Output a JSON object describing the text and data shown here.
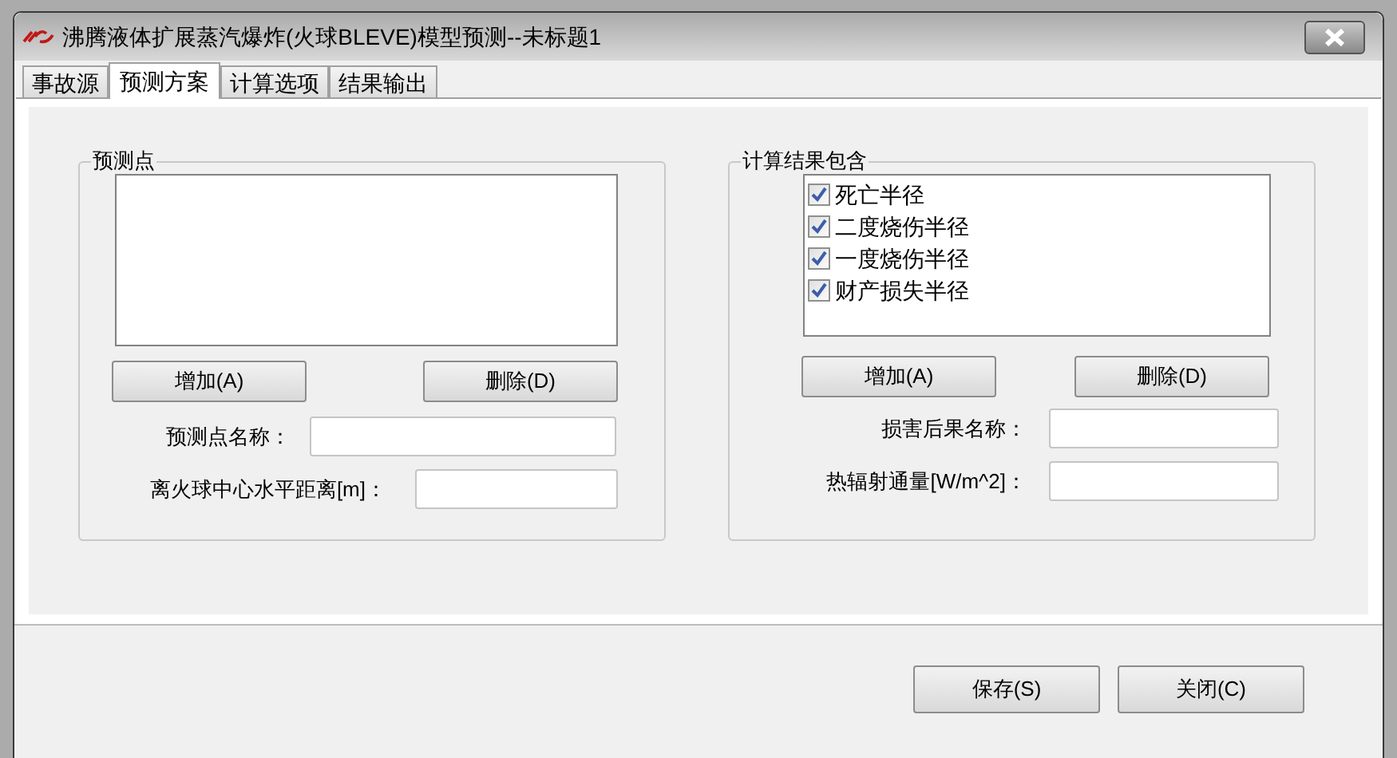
{
  "window": {
    "title": "沸腾液体扩展蒸汽爆炸(火球BLEVE)模型预测--未标题1"
  },
  "tabs": [
    {
      "label": "事故源",
      "selected": false
    },
    {
      "label": "预测方案",
      "selected": true
    },
    {
      "label": "计算选项",
      "selected": false
    },
    {
      "label": "结果输出",
      "selected": false
    }
  ],
  "prediction_points": {
    "title": "预测点",
    "buttons": [
      "增加(A)",
      "删除(D)"
    ],
    "fields": [
      {
        "label": "预测点名称："
      },
      {
        "label": "离火球中心水平距离[m]："
      }
    ]
  },
  "results": {
    "title": "计算结果包含",
    "items": [
      {
        "label": "死亡半径",
        "checked": true
      },
      {
        "label": "二度烧伤半径",
        "checked": true
      },
      {
        "label": "一度烧伤半径",
        "checked": true
      },
      {
        "label": "财产损失半径",
        "checked": true
      }
    ],
    "buttons": [
      "增加(A)",
      "删除(D)"
    ],
    "fields": [
      {
        "label": "损害后果名称："
      },
      {
        "label": "热辐射通量[W/m^2]："
      }
    ]
  },
  "footer_buttons": [
    "保存(S)",
    "关闭(C)"
  ]
}
